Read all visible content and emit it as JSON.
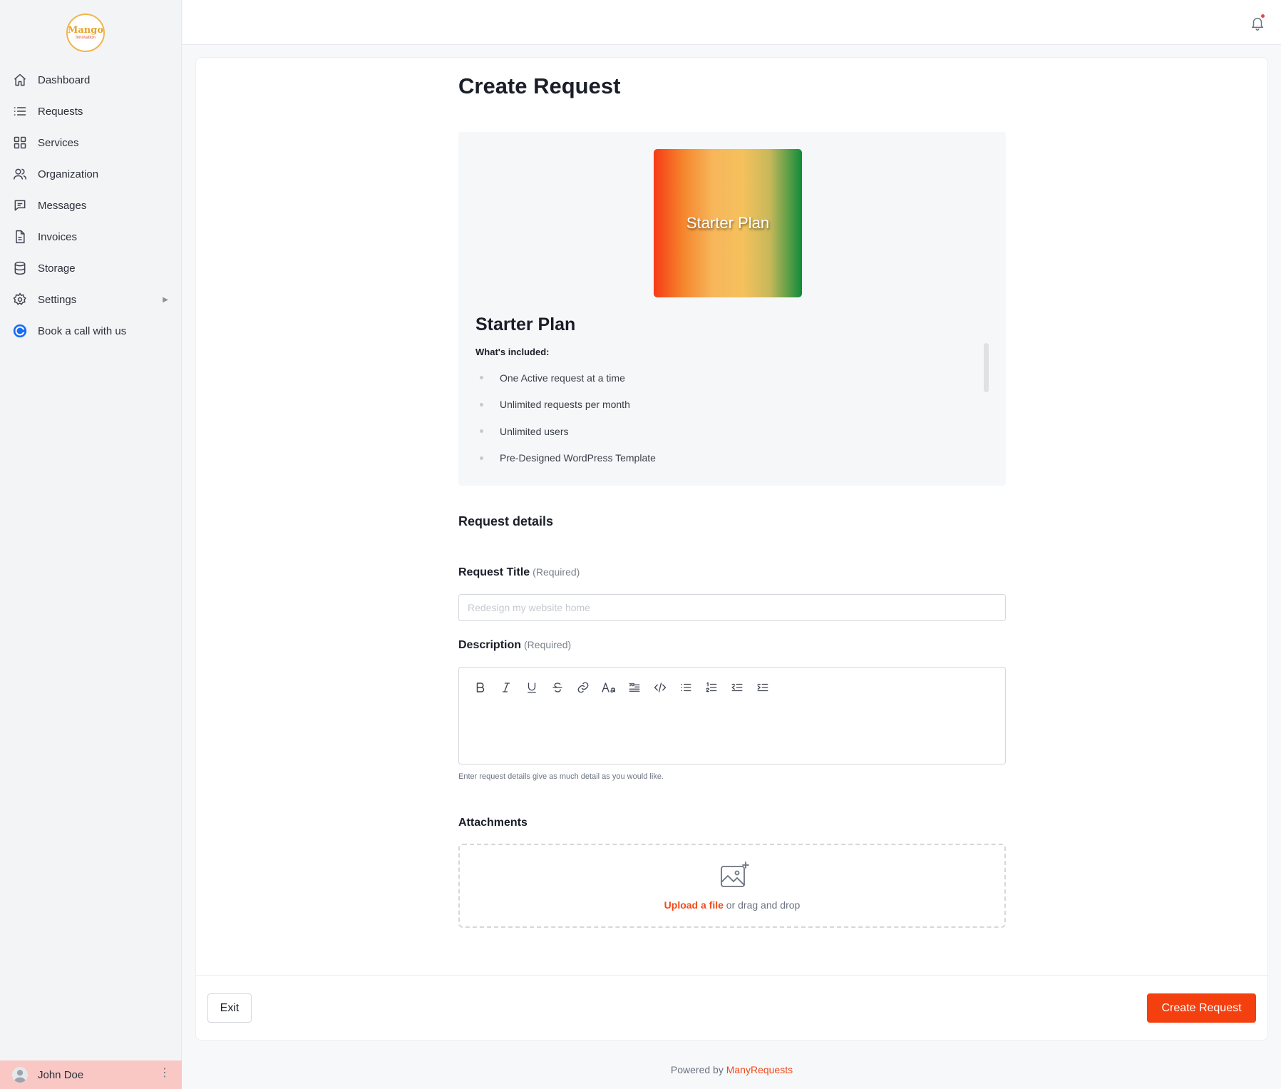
{
  "brand": {
    "logo_line1": "Mango",
    "logo_line2": "Innovation"
  },
  "sidebar": {
    "items": [
      {
        "label": "Dashboard",
        "icon": "home-icon"
      },
      {
        "label": "Requests",
        "icon": "list-icon"
      },
      {
        "label": "Services",
        "icon": "grid-icon"
      },
      {
        "label": "Organization",
        "icon": "users-icon"
      },
      {
        "label": "Messages",
        "icon": "chat-icon"
      },
      {
        "label": "Invoices",
        "icon": "document-icon"
      },
      {
        "label": "Storage",
        "icon": "database-icon"
      },
      {
        "label": "Settings",
        "icon": "gear-icon"
      },
      {
        "label": "Book a call with us",
        "icon": "calendly-icon"
      }
    ],
    "user": {
      "name": "John Doe"
    }
  },
  "page": {
    "title": "Create Request"
  },
  "plan": {
    "image_text": "Starter Plan",
    "name": "Starter Plan",
    "included_heading": "What's included:",
    "features": [
      "One Active request at a time",
      "Unlimited requests per month",
      "Unlimited users",
      "Pre-Designed WordPress Template"
    ]
  },
  "form": {
    "section_title": "Request details",
    "title_label": "Request Title",
    "title_required": "(Required)",
    "title_placeholder": "Redesign my website home",
    "title_value": "",
    "description_label": "Description",
    "description_required": "(Required)",
    "description_helper": "Enter request details give as much detail as you would like.",
    "toolbar": [
      "bold-icon",
      "italic-icon",
      "underline-icon",
      "strikethrough-icon",
      "link-icon",
      "font-size-icon",
      "blockquote-icon",
      "code-icon",
      "bullet-list-icon",
      "numbered-list-icon",
      "outdent-icon",
      "indent-icon"
    ],
    "attachments_title": "Attachments",
    "upload_link": "Upload a file",
    "upload_rest": " or drag and drop"
  },
  "footer": {
    "exit_label": "Exit",
    "create_label": "Create Request",
    "powered_prefix": "Powered by ",
    "powered_brand": "ManyRequests"
  },
  "colors": {
    "accent": "#f43f0f",
    "user_bar": "#f9c8c5",
    "sidebar_bg": "#f3f4f6"
  }
}
